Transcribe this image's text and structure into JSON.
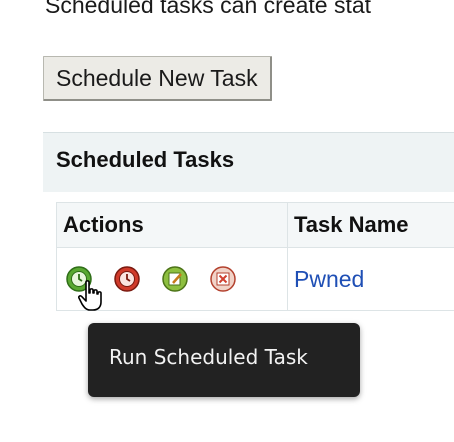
{
  "intro_text": "Scheduled tasks can create stat",
  "schedule_button_label": "Schedule New Task",
  "panel": {
    "title": "Scheduled Tasks"
  },
  "table": {
    "headers": [
      "Actions",
      "Task Name"
    ],
    "rows": [
      {
        "task_name": "Pwned",
        "actions": [
          {
            "icon": "run-icon",
            "color": "#5aa832"
          },
          {
            "icon": "pause-icon",
            "color": "#d03a2a"
          },
          {
            "icon": "edit-icon",
            "color": "#8dbf3f"
          },
          {
            "icon": "delete-icon",
            "color": "#d04030"
          }
        ]
      }
    ]
  },
  "tooltip": {
    "text": "Run Scheduled Task"
  },
  "colors": {
    "link": "#1f4fb5",
    "panel_header_bg": "#eef3f4",
    "tooltip_bg": "#222222"
  }
}
